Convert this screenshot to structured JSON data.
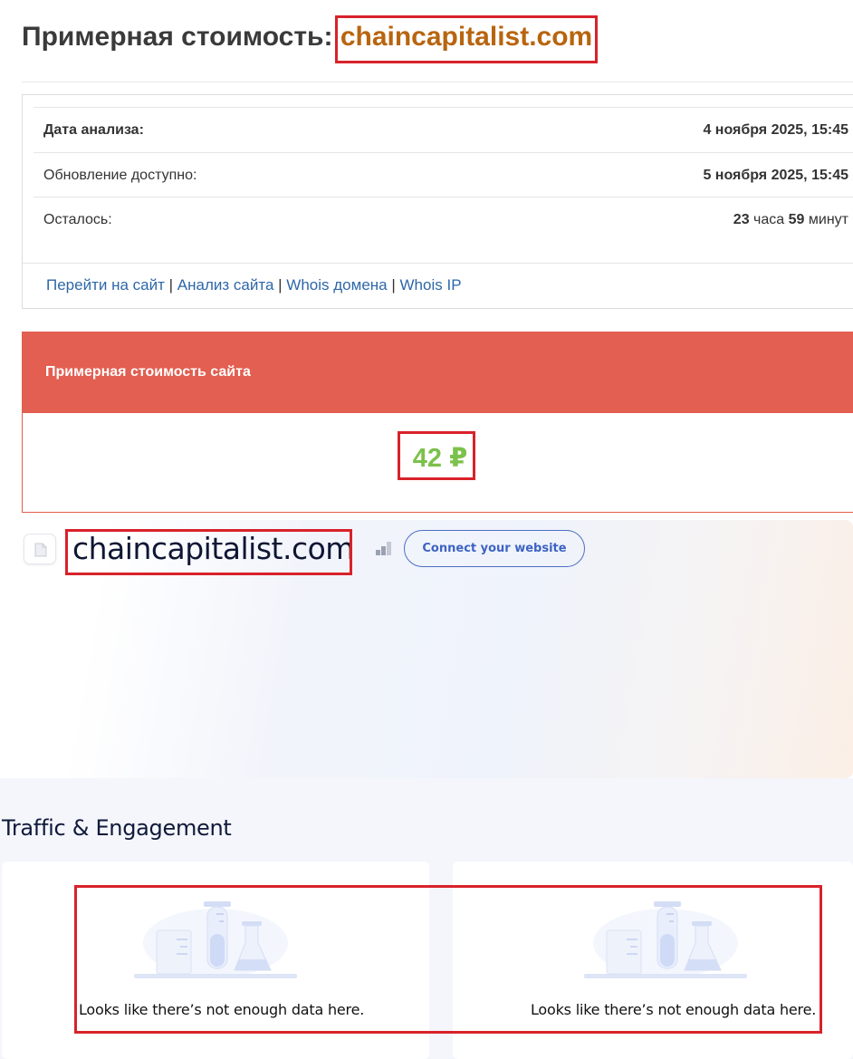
{
  "header": {
    "title_prefix": "Примерная стоимость:",
    "title_domain": "chaincapitalist.com",
    "domain_color": "#b8650f"
  },
  "info": {
    "rows": [
      {
        "label": "Дата анализа:",
        "value": "4 ноября 2025, 15:45"
      },
      {
        "label": "Обновление доступно:",
        "value": "5 ноября 2025, 15:45"
      },
      {
        "label": "Осталось:",
        "hours_num": "23",
        "hours_word": "часа",
        "minutes_num": "59",
        "minutes_word": "минут"
      }
    ],
    "links": [
      "Перейти на сайт",
      "Анализ сайта",
      "Whois домена",
      "Whois IP"
    ],
    "separator": "|"
  },
  "cost_panel": {
    "heading": "Примерная стоимость сайта",
    "price": "42 ₽",
    "header_color": "#e25f51",
    "price_color": "#7cc14b"
  },
  "similarweb": {
    "domain": "chaincapitalist.com",
    "connect_label": "Connect your website",
    "icons": [
      "page-icon",
      "rank-bars-icon"
    ]
  },
  "traffic": {
    "heading": "Traffic & Engagement",
    "cards": [
      {
        "message": "Looks like there’s not enough data here."
      },
      {
        "message": "Looks like there’s not enough data here."
      }
    ]
  },
  "annotation_color": "#d8222a"
}
